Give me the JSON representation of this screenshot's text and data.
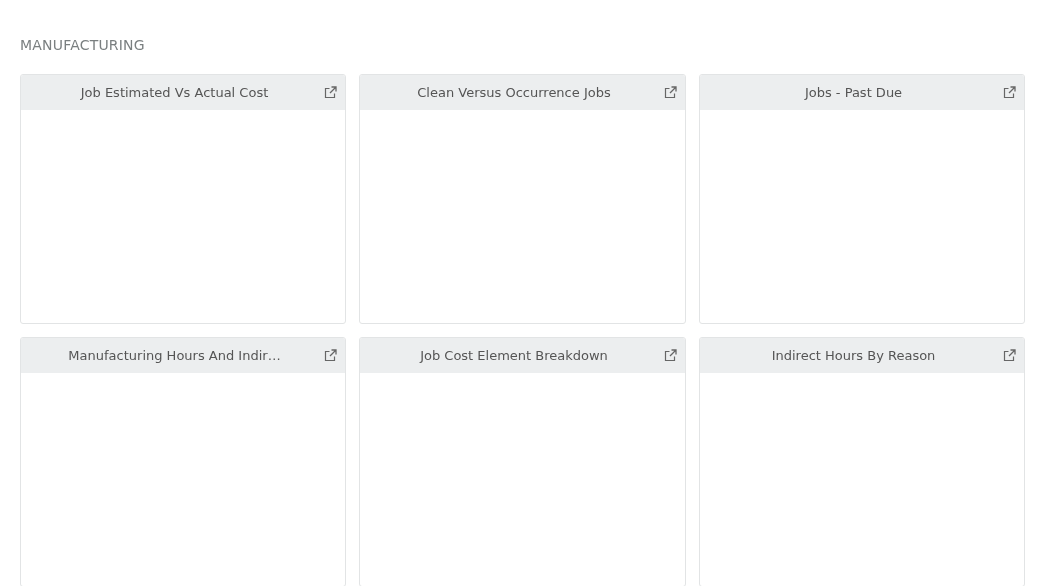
{
  "section": {
    "title": "MANUFACTURING"
  },
  "cards": [
    {
      "title": "Job Estimated Vs Actual Cost"
    },
    {
      "title": "Clean Versus Occurrence Jobs"
    },
    {
      "title": "Jobs - Past Due"
    },
    {
      "title": "Manufacturing Hours And Indir…"
    },
    {
      "title": "Job Cost Element Breakdown"
    },
    {
      "title": "Indirect Hours By Reason"
    }
  ]
}
